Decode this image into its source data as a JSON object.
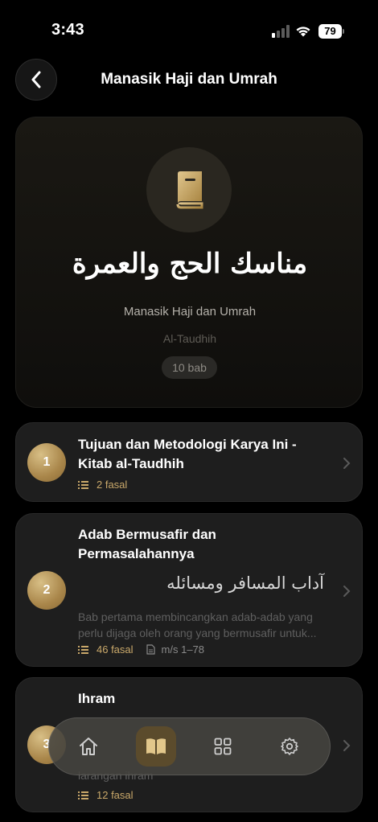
{
  "status_bar": {
    "time": "3:43",
    "battery": "79"
  },
  "header": {
    "title": "Manasik Haji dan Umrah",
    "back_icon": "chevron-left-icon"
  },
  "hero": {
    "icon": "book-icon",
    "arabic_title": "مناسك الحج والعمرة",
    "name": "Manasik Haji dan Umrah",
    "author": "Al-Taudhih",
    "badge": "10 bab"
  },
  "chapters": [
    {
      "number": "1",
      "title": "Tujuan dan Metodologi Karya Ini - Kitab al-Taudhih",
      "fasal": "2 fasal"
    },
    {
      "number": "2",
      "title": "Adab Bermusafir dan Permasalahannya",
      "arabic": "آداب المسافر ومسائله",
      "description": "Bab pertama membincangkan adab-adab yang perlu dijaga oleh orang yang bermusafir untuk...",
      "fasal": "46 fasal",
      "pages": "m/s 1–78"
    },
    {
      "number": "3",
      "title": "Ihram",
      "description": "larangan ihram",
      "fasal": "12 fasal"
    }
  ],
  "bottom_nav": {
    "items": [
      "home-icon",
      "open-book-icon",
      "grid-icon",
      "settings-icon"
    ],
    "active": "open-book-icon"
  },
  "colors": {
    "accent_gold": "#c9a86a",
    "background": "#000000",
    "card": "#1e1e1e"
  }
}
